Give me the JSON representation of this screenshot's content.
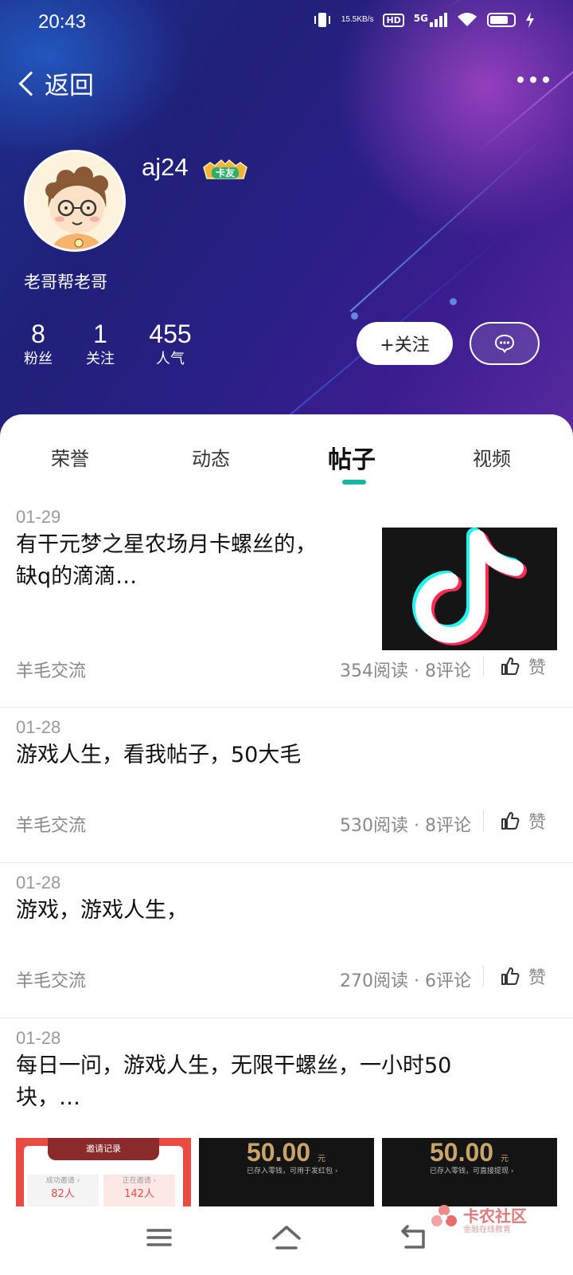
{
  "status_bar": {
    "time": "20:43",
    "speed_value": "15.5",
    "speed_unit": "KB/s",
    "hd_label": "HD",
    "network": "5G",
    "battery_level": 0.8
  },
  "header": {
    "back_label": "返回"
  },
  "profile": {
    "username": "aj24",
    "badge_label": "卡友",
    "signature": "老哥帮老哥",
    "stats": [
      {
        "value": "8",
        "label": "粉丝"
      },
      {
        "value": "1",
        "label": "关注"
      },
      {
        "value": "455",
        "label": "人气"
      }
    ],
    "follow_label": "+关注"
  },
  "tabs": [
    "荣誉",
    "动态",
    "帖子",
    "视频"
  ],
  "active_tab": "帖子",
  "posts": [
    {
      "date": "01-29",
      "title_line1": "有干元梦之星农场月卡螺丝的，",
      "title_line2": "缺q的滴滴…",
      "category": "羊毛交流",
      "meta": "354阅读 · 8评论",
      "like_label": "赞"
    },
    {
      "date": "01-28",
      "title_line1": "游戏人生，看我帖子，50大毛",
      "category": "羊毛交流",
      "meta": "530阅读 · 8评论",
      "like_label": "赞"
    },
    {
      "date": "01-28",
      "title_line1": "游戏，游戏人生，",
      "category": "羊毛交流",
      "meta": "270阅读 · 6评论",
      "like_label": "赞"
    },
    {
      "date": "01-28",
      "title_line1": "每日一问，游戏人生，无限干螺丝，一小时50",
      "title_line2": "块，…"
    }
  ],
  "images": {
    "invite_title": "邀请记录",
    "invite_cells": [
      {
        "label": "成功邀请 ›",
        "value": "82人"
      },
      {
        "label": "正在邀请 ›",
        "value": "142人"
      }
    ],
    "cards": [
      {
        "amount": "50.00",
        "unit": "元",
        "sub": "已存入零钱，可用于发红包 ›"
      },
      {
        "amount": "50.00",
        "unit": "元",
        "sub": "已存入零钱，可直接提现 ›"
      }
    ]
  },
  "watermark": {
    "title": "卡农社区",
    "subtitle": "金融在线教育"
  },
  "colors": {
    "accent": "#17b5a5",
    "hero_start": "#1d2f8c",
    "hero_end": "#5a2aa0"
  }
}
